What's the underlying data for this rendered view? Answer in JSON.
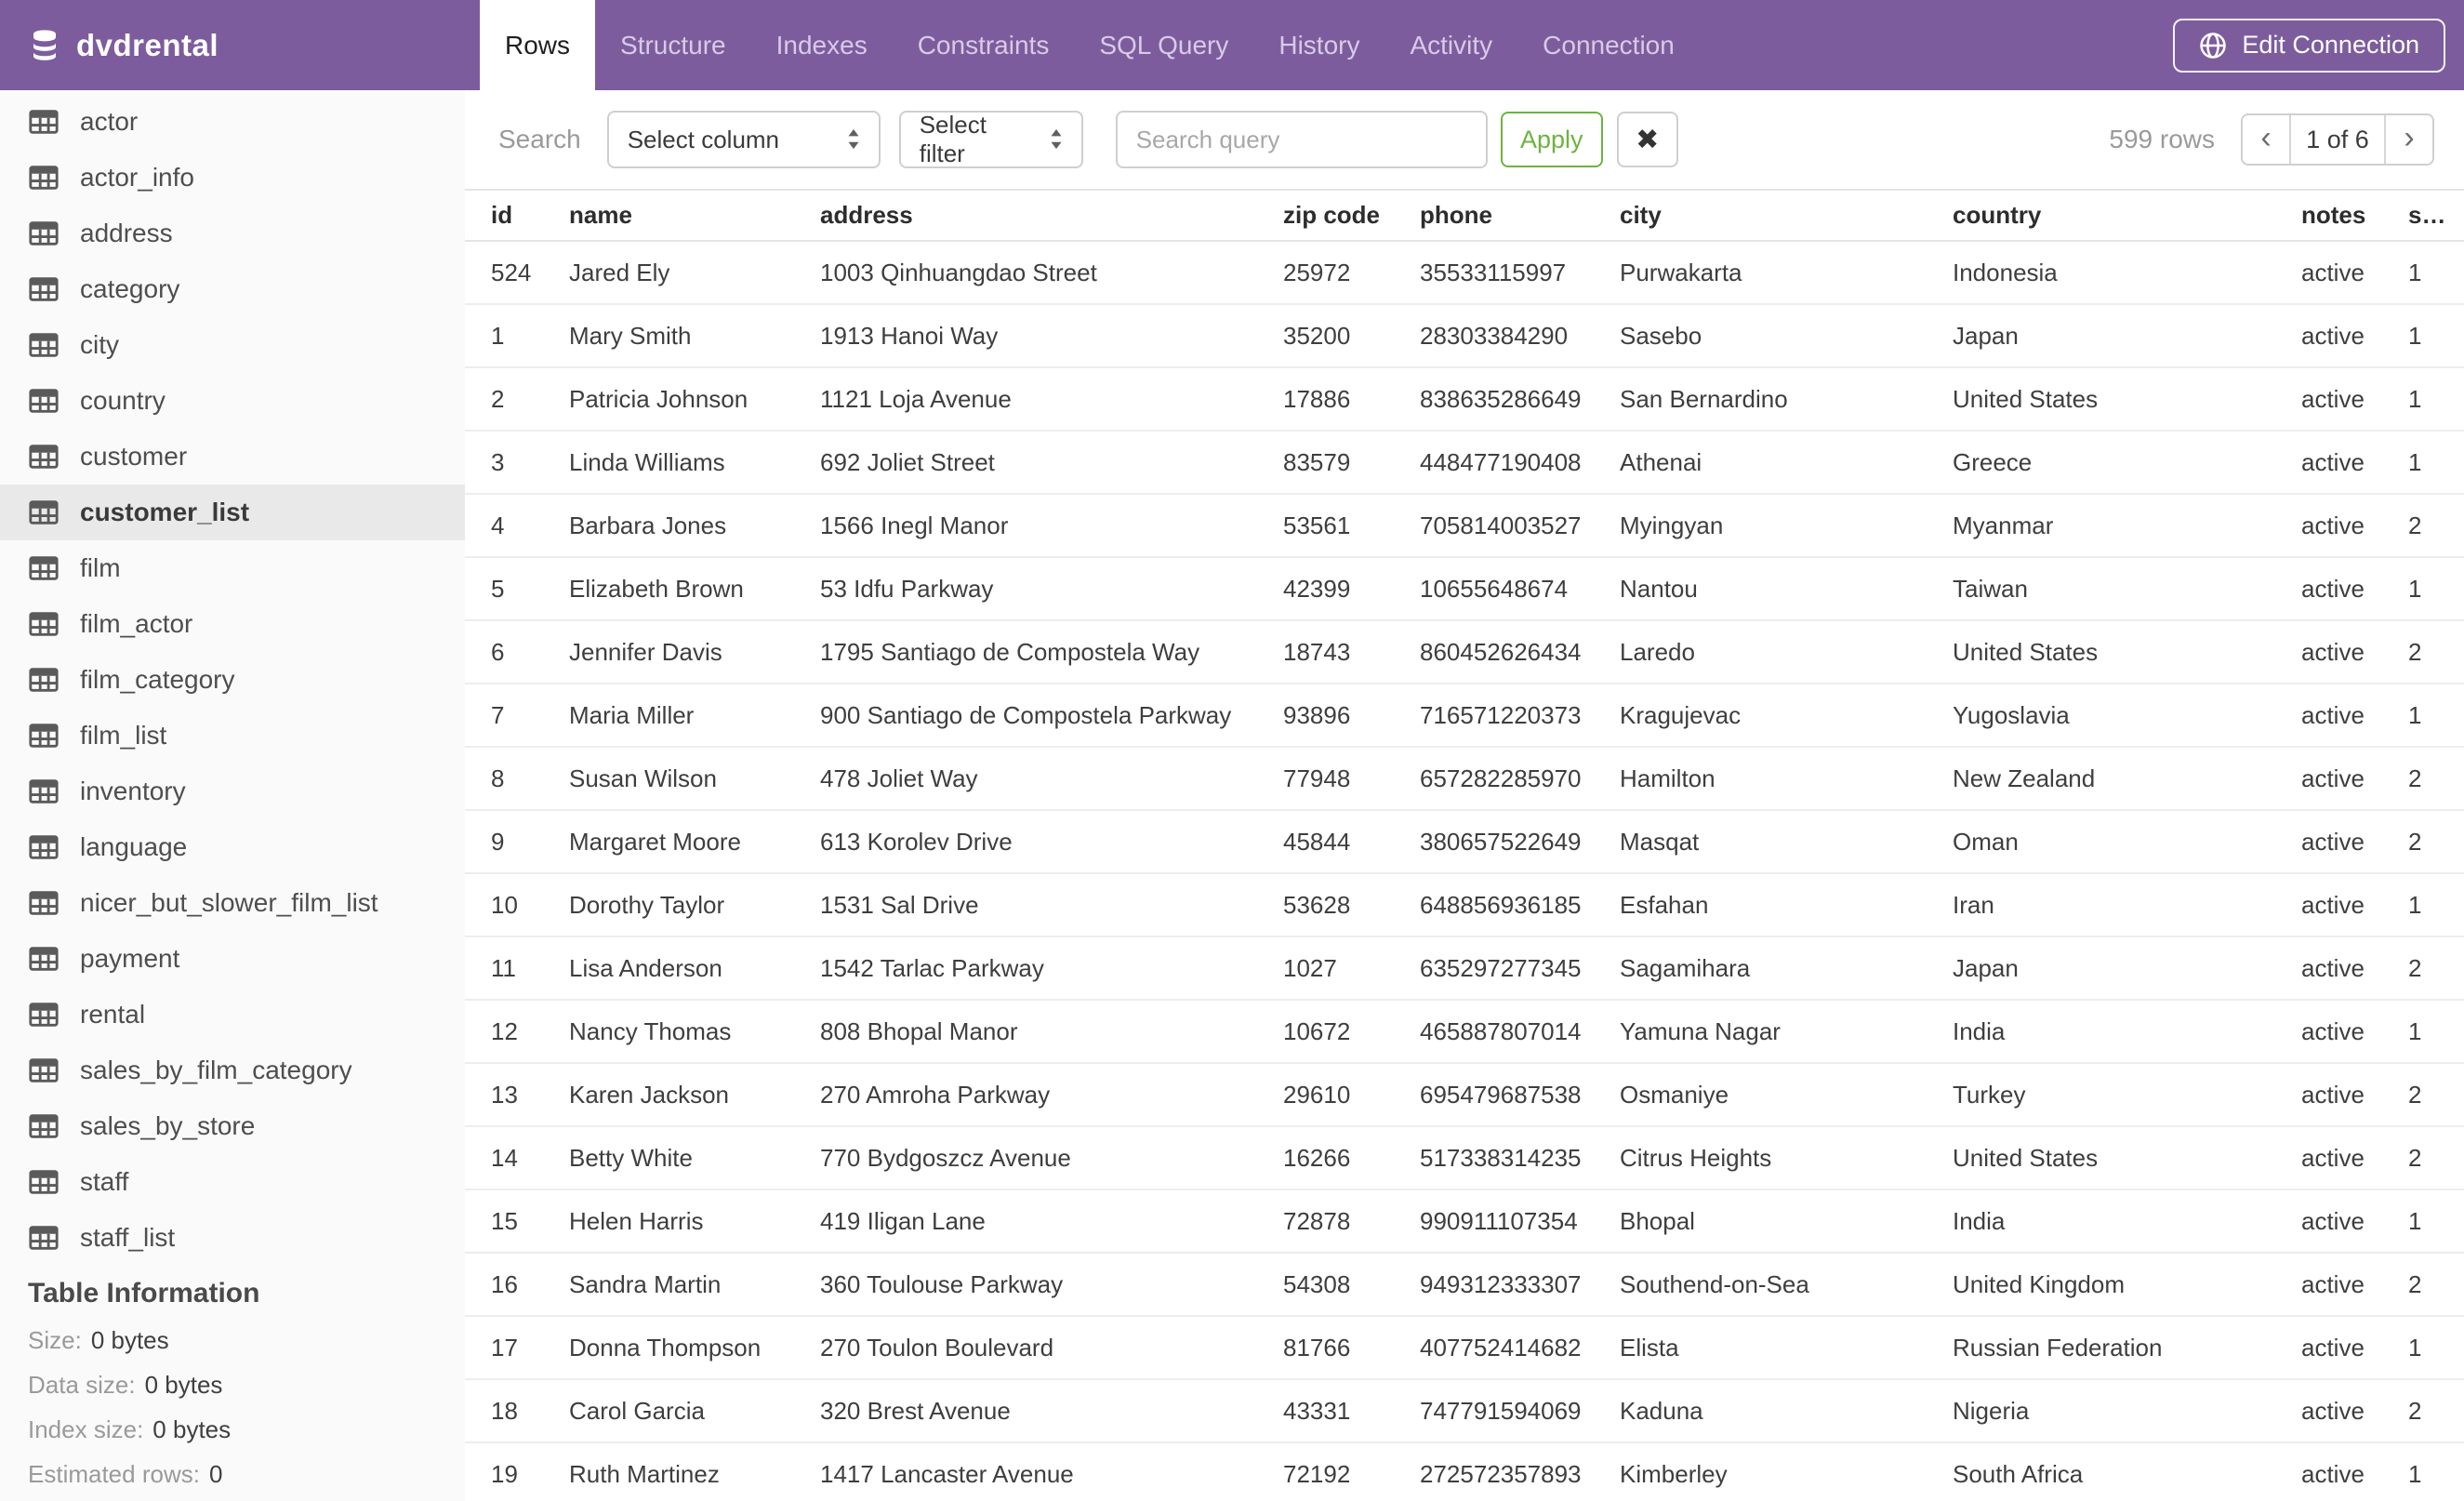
{
  "header": {
    "database_name": "dvdrental",
    "tabs": [
      {
        "label": "Rows",
        "active": true
      },
      {
        "label": "Structure",
        "active": false
      },
      {
        "label": "Indexes",
        "active": false
      },
      {
        "label": "Constraints",
        "active": false
      },
      {
        "label": "SQL Query",
        "active": false
      },
      {
        "label": "History",
        "active": false
      },
      {
        "label": "Activity",
        "active": false
      },
      {
        "label": "Connection",
        "active": false
      }
    ],
    "edit_connection_label": "Edit Connection"
  },
  "sidebar": {
    "tables": [
      "actor",
      "actor_info",
      "address",
      "category",
      "city",
      "country",
      "customer",
      "customer_list",
      "film",
      "film_actor",
      "film_category",
      "film_list",
      "inventory",
      "language",
      "nicer_but_slower_film_list",
      "payment",
      "rental",
      "sales_by_film_category",
      "sales_by_store",
      "staff",
      "staff_list"
    ],
    "selected_table": "customer_list",
    "table_information": {
      "title": "Table Information",
      "rows": [
        {
          "label": "Size:",
          "value": "0 bytes"
        },
        {
          "label": "Data size:",
          "value": "0 bytes"
        },
        {
          "label": "Index size:",
          "value": "0 bytes"
        },
        {
          "label": "Estimated rows:",
          "value": "0"
        }
      ]
    }
  },
  "toolbar": {
    "search_label": "Search",
    "column_select_value": "Select column",
    "filter_select_value": "Select filter",
    "query_placeholder": "Search query",
    "query_value": "",
    "apply_label": "Apply",
    "clear_label": "✖",
    "row_count": "599 rows",
    "pagination": {
      "prev": "‹",
      "current_page": "1 of 6",
      "next": "›"
    }
  },
  "table": {
    "columns": [
      "id",
      "name",
      "address",
      "zip code",
      "phone",
      "city",
      "country",
      "notes",
      "sid"
    ],
    "rows": [
      [
        "524",
        "Jared Ely",
        "1003 Qinhuangdao Street",
        "25972",
        "35533115997",
        "Purwakarta",
        "Indonesia",
        "active",
        "1"
      ],
      [
        "1",
        "Mary Smith",
        "1913 Hanoi Way",
        "35200",
        "28303384290",
        "Sasebo",
        "Japan",
        "active",
        "1"
      ],
      [
        "2",
        "Patricia Johnson",
        "1121 Loja Avenue",
        "17886",
        "838635286649",
        "San Bernardino",
        "United States",
        "active",
        "1"
      ],
      [
        "3",
        "Linda Williams",
        "692 Joliet Street",
        "83579",
        "448477190408",
        "Athenai",
        "Greece",
        "active",
        "1"
      ],
      [
        "4",
        "Barbara Jones",
        "1566 Inegl Manor",
        "53561",
        "705814003527",
        "Myingyan",
        "Myanmar",
        "active",
        "2"
      ],
      [
        "5",
        "Elizabeth Brown",
        "53 Idfu Parkway",
        "42399",
        "10655648674",
        "Nantou",
        "Taiwan",
        "active",
        "1"
      ],
      [
        "6",
        "Jennifer Davis",
        "1795 Santiago de Compostela Way",
        "18743",
        "860452626434",
        "Laredo",
        "United States",
        "active",
        "2"
      ],
      [
        "7",
        "Maria Miller",
        "900 Santiago de Compostela Parkway",
        "93896",
        "716571220373",
        "Kragujevac",
        "Yugoslavia",
        "active",
        "1"
      ],
      [
        "8",
        "Susan Wilson",
        "478 Joliet Way",
        "77948",
        "657282285970",
        "Hamilton",
        "New Zealand",
        "active",
        "2"
      ],
      [
        "9",
        "Margaret Moore",
        "613 Korolev Drive",
        "45844",
        "380657522649",
        "Masqat",
        "Oman",
        "active",
        "2"
      ],
      [
        "10",
        "Dorothy Taylor",
        "1531 Sal Drive",
        "53628",
        "648856936185",
        "Esfahan",
        "Iran",
        "active",
        "1"
      ],
      [
        "11",
        "Lisa Anderson",
        "1542 Tarlac Parkway",
        "1027",
        "635297277345",
        "Sagamihara",
        "Japan",
        "active",
        "2"
      ],
      [
        "12",
        "Nancy Thomas",
        "808 Bhopal Manor",
        "10672",
        "465887807014",
        "Yamuna Nagar",
        "India",
        "active",
        "1"
      ],
      [
        "13",
        "Karen Jackson",
        "270 Amroha Parkway",
        "29610",
        "695479687538",
        "Osmaniye",
        "Turkey",
        "active",
        "2"
      ],
      [
        "14",
        "Betty White",
        "770 Bydgoszcz Avenue",
        "16266",
        "517338314235",
        "Citrus Heights",
        "United States",
        "active",
        "2"
      ],
      [
        "15",
        "Helen Harris",
        "419 Iligan Lane",
        "72878",
        "990911107354",
        "Bhopal",
        "India",
        "active",
        "1"
      ],
      [
        "16",
        "Sandra Martin",
        "360 Toulouse Parkway",
        "54308",
        "949312333307",
        "Southend-on-Sea",
        "United Kingdom",
        "active",
        "2"
      ],
      [
        "17",
        "Donna Thompson",
        "270 Toulon Boulevard",
        "81766",
        "407752414682",
        "Elista",
        "Russian Federation",
        "active",
        "1"
      ],
      [
        "18",
        "Carol Garcia",
        "320 Brest Avenue",
        "43331",
        "747791594069",
        "Kaduna",
        "Nigeria",
        "active",
        "2"
      ],
      [
        "19",
        "Ruth Martinez",
        "1417 Lancaster Avenue",
        "72192",
        "272572357893",
        "Kimberley",
        "South Africa",
        "active",
        "1"
      ]
    ]
  },
  "colors": {
    "header_purple": "#7d5c9e",
    "accent_green": "#6db33f",
    "selected_item_bg": "#e9e9e9"
  }
}
